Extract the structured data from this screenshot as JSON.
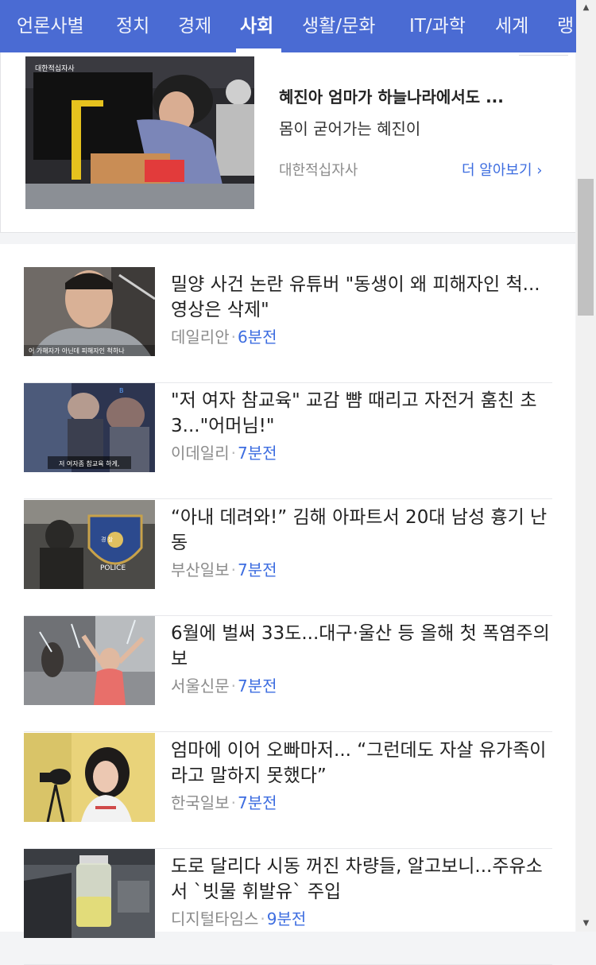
{
  "nav": {
    "tabs": [
      {
        "label": "언론사별"
      },
      {
        "label": "정치"
      },
      {
        "label": "경제"
      },
      {
        "label": "사회"
      },
      {
        "label": "생활/문화"
      },
      {
        "label": "IT/과학"
      },
      {
        "label": "세계"
      },
      {
        "label": "랭"
      }
    ],
    "active": "사회"
  },
  "ad": {
    "thumb_caption": "대한적십자사",
    "title": "혜진아 엄마가 하늘나라에서도 ...",
    "subtitle": "몸이 굳어가는 혜진이",
    "source": "대한적십자사",
    "more_label": "더 알아보기"
  },
  "news": [
    {
      "headline": "밀양 사건 논란 유튜버 \"동생이 왜 피해자인 척...영상은 삭제\"",
      "source": "데일리안",
      "time": "6분전",
      "thumb_caption": "어 가해자가 아닌데 피해자인 척하나"
    },
    {
      "headline": "\"저 여자 참교육\" 교감 뺨 때리고 자전거 훔친 초3...\"어머님!\"",
      "source": "이데일리",
      "time": "7분전",
      "thumb_caption": "저 여자좀 참교육 하게,"
    },
    {
      "headline": "“아내 데려와!” 김해 아파트서 20대 남성 흉기 난동",
      "source": "부산일보",
      "time": "7분전",
      "thumb_caption": "POLICE",
      "thumb_caption2": "경 찰"
    },
    {
      "headline": "6월에 벌써 33도...대구·울산 등 올해 첫 폭염주의보",
      "source": "서울신문",
      "time": "7분전"
    },
    {
      "headline": "엄마에 이어 오빠마저... “그런데도 자살 유가족이라고 말하지 못했다”",
      "source": "한국일보",
      "time": "7분전"
    },
    {
      "headline": "도로 달리다 시동 꺼진 차량들, 알고보니...주유소서 `빗물 휘발유` 주입",
      "source": "디지털타임스",
      "time": "9분전"
    }
  ],
  "colors": {
    "nav_bg": "#4a6bd3",
    "accent_blue": "#3d6de0",
    "source_gray": "#8b8b8b"
  }
}
